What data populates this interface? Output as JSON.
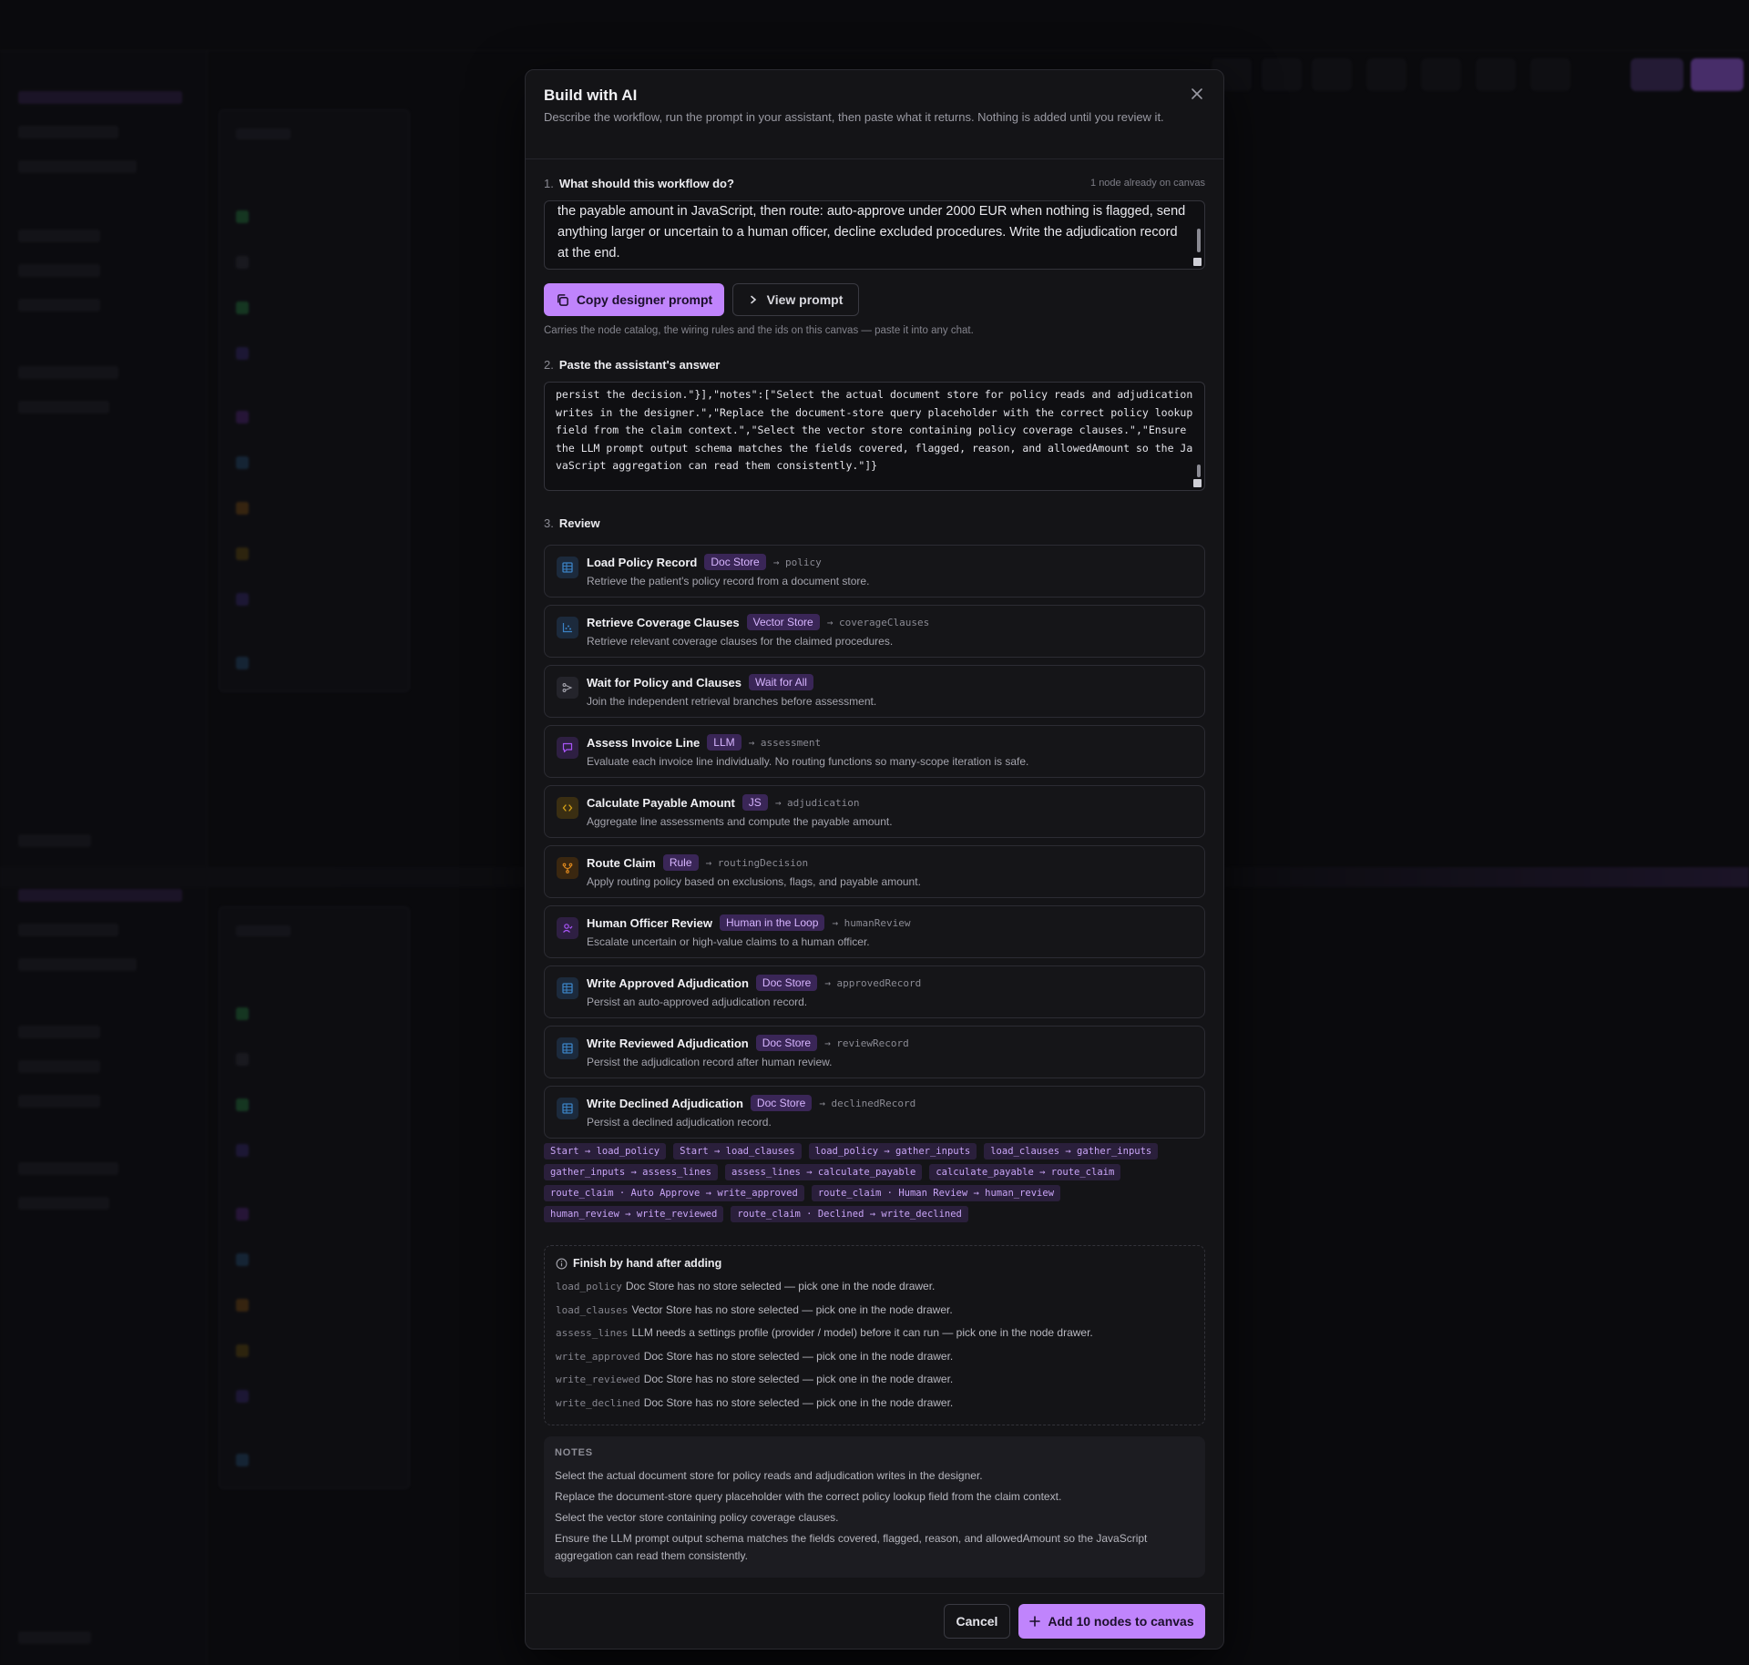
{
  "modal": {
    "title": "Build with AI",
    "description": "Describe the workflow, run the prompt in your assistant, then paste what it returns. Nothing is added until you review it.",
    "close_icon": "close-icon"
  },
  "step1": {
    "number": "1.",
    "label": "What should this workflow do?",
    "aside": "1 node already on canvas",
    "text": "the payable amount in JavaScript, then route: auto-approve under 2000 EUR when nothing is flagged, send anything larger or uncertain to a human officer, decline excluded procedures. Write the adjudication record at the end.",
    "copy_label": "Copy designer prompt",
    "view_label": "View prompt",
    "hint": "Carries the node catalog, the wiring rules and the ids on this canvas — paste it into any chat."
  },
  "step2": {
    "number": "2.",
    "label": "Paste the assistant's answer",
    "text": "persist the decision.\"}],\"notes\":[\"Select the actual document store for policy reads and adjudication writes in the designer.\",\"Replace the document-store query placeholder with the correct policy lookup field from the claim context.\",\"Select the vector store containing policy coverage clauses.\",\"Ensure the LLM prompt output schema matches the fields covered, flagged, reason, and allowedAmount so the JavaScript aggregation can read them consistently.\"]}"
  },
  "step3": {
    "number": "3.",
    "label": "Review",
    "nodes": [
      {
        "title": "Load Policy Record",
        "badge": "Doc Store",
        "output": "→ policy",
        "desc": "Retrieve the patient's policy record from a document store.",
        "icon": "table-icon"
      },
      {
        "title": "Retrieve Coverage Clauses",
        "badge": "Vector Store",
        "output": "→ coverageClauses",
        "desc": "Retrieve relevant coverage clauses for the claimed procedures.",
        "icon": "scatter-icon"
      },
      {
        "title": "Wait for Policy and Clauses",
        "badge": "Wait for All",
        "output": "",
        "desc": "Join the independent retrieval branches before assessment.",
        "icon": "merge-icon"
      },
      {
        "title": "Assess Invoice Line",
        "badge": "LLM",
        "output": "→ assessment",
        "desc": "Evaluate each invoice line individually. No routing functions so many-scope iteration is safe.",
        "icon": "chat-icon"
      },
      {
        "title": "Calculate Payable Amount",
        "badge": "JS",
        "output": "→ adjudication",
        "desc": "Aggregate line assessments and compute the payable amount.",
        "icon": "code-icon"
      },
      {
        "title": "Route Claim",
        "badge": "Rule",
        "output": "→ routingDecision",
        "desc": "Apply routing policy based on exclusions, flags, and payable amount.",
        "icon": "branch-icon"
      },
      {
        "title": "Human Officer Review",
        "badge": "Human in the Loop",
        "output": "→ humanReview",
        "desc": "Escalate uncertain or high-value claims to a human officer.",
        "icon": "person-icon"
      },
      {
        "title": "Write Approved Adjudication",
        "badge": "Doc Store",
        "output": "→ approvedRecord",
        "desc": "Persist an auto-approved adjudication record.",
        "icon": "table-icon"
      },
      {
        "title": "Write Reviewed Adjudication",
        "badge": "Doc Store",
        "output": "→ reviewRecord",
        "desc": "Persist the adjudication record after human review.",
        "icon": "table-icon"
      },
      {
        "title": "Write Declined Adjudication",
        "badge": "Doc Store",
        "output": "→ declinedRecord",
        "desc": "Persist a declined adjudication record.",
        "icon": "table-icon"
      }
    ],
    "edges": [
      [
        "Start → load_policy",
        "Start → load_clauses",
        "load_policy → gather_inputs",
        "load_clauses → gather_inputs"
      ],
      [
        "gather_inputs → assess_lines",
        "assess_lines → calculate_payable",
        "calculate_payable → route_claim"
      ],
      [
        "route_claim · Auto Approve → write_approved",
        "route_claim · Human Review → human_review"
      ],
      [
        "human_review → write_reviewed",
        "route_claim · Declined → write_declined"
      ]
    ],
    "finish_title": "Finish by hand after adding",
    "finish_items": [
      {
        "code": "load_policy",
        "text": "Doc Store has no store selected — pick one in the node drawer."
      },
      {
        "code": "load_clauses",
        "text": "Vector Store has no store selected — pick one in the node drawer."
      },
      {
        "code": "assess_lines",
        "text": "LLM needs a settings profile (provider / model) before it can run — pick one in the node drawer."
      },
      {
        "code": "write_approved",
        "text": "Doc Store has no store selected — pick one in the node drawer."
      },
      {
        "code": "write_reviewed",
        "text": "Doc Store has no store selected — pick one in the node drawer."
      },
      {
        "code": "write_declined",
        "text": "Doc Store has no store selected — pick one in the node drawer."
      }
    ],
    "notes_title": "NOTES",
    "notes": [
      "Select the actual document store for policy reads and adjudication writes in the designer.",
      "Replace the document-store query placeholder with the correct policy lookup field from the claim context.",
      "Select the vector store containing policy coverage clauses.",
      "Ensure the LLM prompt output schema matches the fields covered, flagged, reason, and allowedAmount so the JavaScript aggregation can read them consistently."
    ]
  },
  "footer": {
    "cancel_label": "Cancel",
    "add_label": "Add 10 nodes to canvas"
  },
  "colors": {
    "accent": "#c084fc",
    "badge_bg": "#3a2657",
    "doc_store_icon": "#3b82c4",
    "llm_icon": "#a855f7",
    "js_icon": "#d4a017",
    "rule_icon": "#e08a1e"
  }
}
